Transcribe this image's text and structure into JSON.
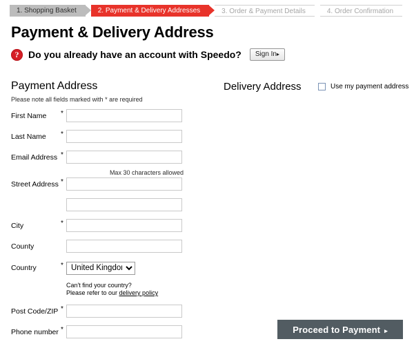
{
  "steps": [
    {
      "label": "1. Shopping Basket",
      "state": "done"
    },
    {
      "label": "2. Payment & Delivery Addresses",
      "state": "current"
    },
    {
      "label": "3. Order & Payment Details",
      "state": "todo"
    },
    {
      "label": "4. Order Confirmation",
      "state": "todo"
    }
  ],
  "page": {
    "title": "Payment & Delivery Address"
  },
  "account": {
    "icon": "question-mark-icon",
    "icon_glyph": "?",
    "prompt": "Do you already have an account with Speedo?",
    "signin_label": "Sign In",
    "signin_arrow": "▸"
  },
  "payment": {
    "heading": "Payment Address",
    "note": "Please note all fields marked with * are required",
    "max_note": "Max 30 characters allowed",
    "required_marker": "*",
    "fields": [
      {
        "label": "First Name",
        "required": true,
        "value": "",
        "placeholder": ""
      },
      {
        "label": "Last Name",
        "required": true,
        "value": "",
        "placeholder": ""
      },
      {
        "label": "Email Address",
        "required": true,
        "value": "",
        "placeholder": ""
      },
      {
        "label": "Street Address",
        "required": true,
        "value": "",
        "placeholder": ""
      },
      {
        "label": "",
        "required": false,
        "value": "",
        "placeholder": ""
      },
      {
        "label": "City",
        "required": true,
        "value": "",
        "placeholder": ""
      },
      {
        "label": "County",
        "required": false,
        "value": "",
        "placeholder": ""
      },
      {
        "label": "Post Code/ZIP",
        "required": true,
        "value": "",
        "placeholder": ""
      },
      {
        "label": "Phone number",
        "required": true,
        "value": "",
        "placeholder": ""
      }
    ],
    "country": {
      "label": "Country",
      "required": true,
      "selected": "United Kingdom",
      "options": [
        "United Kingdom"
      ],
      "note_line1": "Can't find your country?",
      "note_line2_prefix": "Please refer to our ",
      "note_link": "delivery policy"
    }
  },
  "delivery": {
    "heading": "Delivery Address",
    "use_payment_label": "Use my payment address",
    "use_payment_checked": false
  },
  "footer": {
    "proceed_label": "Proceed to Payment",
    "proceed_arrow": "▸"
  },
  "colors": {
    "current_step": "#e8332a",
    "done_step": "#bcbcbc",
    "todo_step_text": "#a6a6a6",
    "proceed_button": "#525c62",
    "help_icon": "#d61f26"
  }
}
